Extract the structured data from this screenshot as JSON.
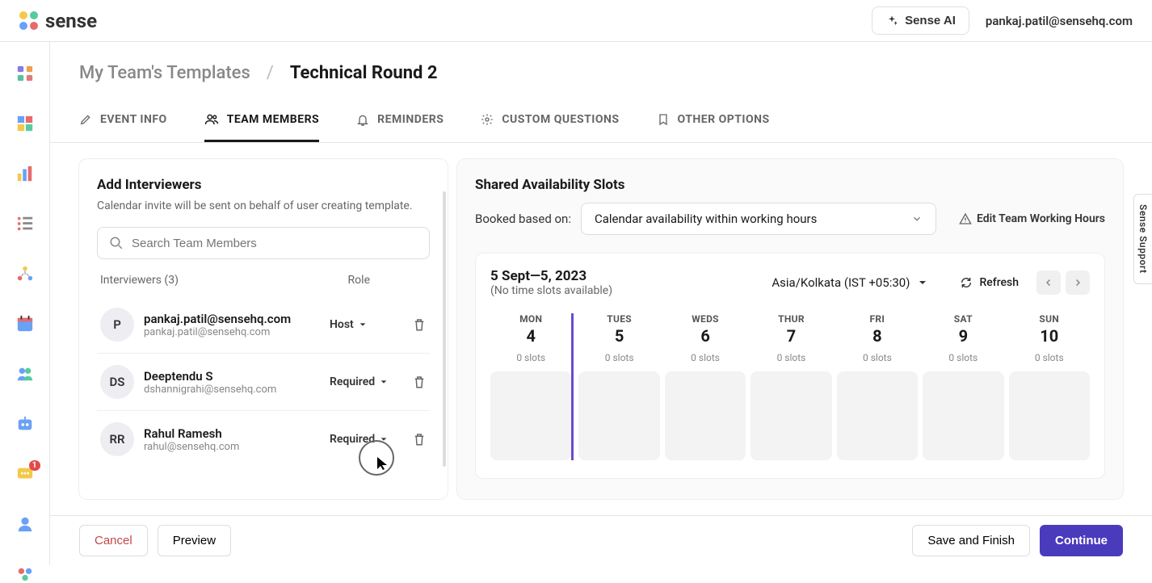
{
  "header": {
    "brand": "sense",
    "ai_button": "Sense AI",
    "user_email": "pankaj.patil@sensehq.com"
  },
  "breadcrumb": {
    "parent": "My Team's Templates",
    "separator": "/",
    "current": "Technical Round 2"
  },
  "tabs": [
    {
      "id": "event-info",
      "label": "EVENT INFO"
    },
    {
      "id": "team-members",
      "label": "TEAM MEMBERS",
      "active": true
    },
    {
      "id": "reminders",
      "label": "REMINDERS"
    },
    {
      "id": "custom-questions",
      "label": "CUSTOM QUESTIONS"
    },
    {
      "id": "other-options",
      "label": "OTHER OPTIONS"
    }
  ],
  "interviewers": {
    "title": "Add Interviewers",
    "subtitle": "Calendar invite will be sent on behalf of user creating template.",
    "search_placeholder": "Search Team Members",
    "count_label": "Interviewers (3)",
    "role_header": "Role",
    "rows": [
      {
        "initials": "P",
        "name": "pankaj.patil@sensehq.com",
        "email": "pankaj.patil@sensehq.com",
        "role": "Host"
      },
      {
        "initials": "DS",
        "name": "Deeptendu S",
        "email": "dshannigrahi@sensehq.com",
        "role": "Required"
      },
      {
        "initials": "RR",
        "name": "Rahul Ramesh",
        "email": "rahul@sensehq.com",
        "role": "Required"
      }
    ]
  },
  "availability": {
    "title": "Shared Availability Slots",
    "basis_label": "Booked based on:",
    "basis_value": "Calendar availability within working hours",
    "edit_hours": "Edit Team Working Hours",
    "date_range": "5 Sept—5, 2023",
    "date_sub": "(No time slots available)",
    "timezone": "Asia/Kolkata (IST +05:30)",
    "refresh": "Refresh",
    "days": [
      {
        "name": "MON",
        "num": "4",
        "slots": "0 slots"
      },
      {
        "name": "TUES",
        "num": "5",
        "slots": "0 slots",
        "today": true
      },
      {
        "name": "WEDS",
        "num": "6",
        "slots": "0 slots"
      },
      {
        "name": "THUR",
        "num": "7",
        "slots": "0 slots"
      },
      {
        "name": "FRI",
        "num": "8",
        "slots": "0 slots"
      },
      {
        "name": "SAT",
        "num": "9",
        "slots": "0 slots"
      },
      {
        "name": "SUN",
        "num": "10",
        "slots": "0 slots"
      }
    ]
  },
  "footer": {
    "cancel": "Cancel",
    "preview": "Preview",
    "save": "Save and Finish",
    "continue": "Continue"
  },
  "support_tab": "Sense Support",
  "rail_badge": "1"
}
